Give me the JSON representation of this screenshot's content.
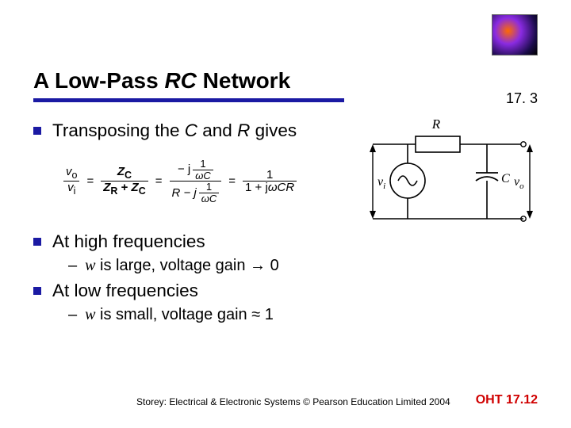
{
  "header": {
    "title_pre": "A Low-Pass ",
    "title_rc": "RC",
    "title_post": " Network",
    "page_num": "17. 3"
  },
  "bullets": {
    "b1_pre": "Transposing the ",
    "b1_c": "C",
    "b1_mid": " and ",
    "b1_r": "R",
    "b1_post": " gives",
    "b2": "At high frequencies",
    "s2_pre": "",
    "s2_om": "w",
    "s2_post": " is large, voltage gain ",
    "s2_arrow": "→",
    "s2_val": " 0",
    "b3": "At low frequencies",
    "s3_pre": "",
    "s3_om": "w",
    "s3_post": " is small, voltage gain ",
    "s3_approx": "≈",
    "s3_val": " 1"
  },
  "eqn": {
    "vo": "v",
    "vo_sub": "o",
    "vi": "v",
    "vi_sub": "i",
    "ZC": "Z",
    "ZC_sub": "C",
    "ZR": "Z",
    "ZR_sub": "R",
    "plus": "+",
    "eq": "=",
    "mj": "− j",
    "one": "1",
    "wC": "ωC",
    "R": "R",
    "Rmj": "R − j",
    "final_num": "1",
    "final_den_pre": "1 + j",
    "final_den_om": "ω",
    "final_den_post": "CR"
  },
  "circuit": {
    "R": "R",
    "vi": "v",
    "vi_sub": "i",
    "vo": "v",
    "vo_sub": "o",
    "C": "C"
  },
  "footer": {
    "copyright": "Storey: Electrical & Electronic Systems © Pearson Education Limited 2004",
    "oht": "OHT 17.12"
  }
}
